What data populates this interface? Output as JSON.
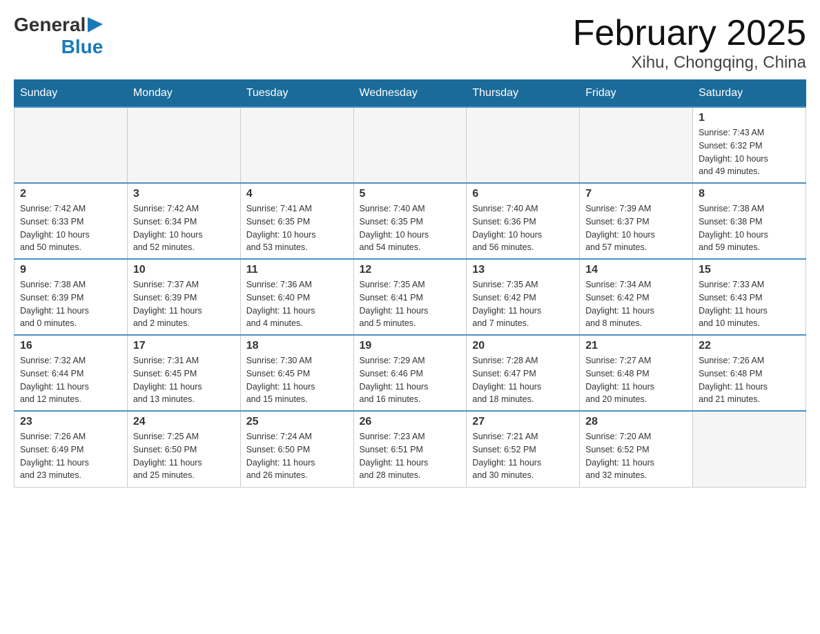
{
  "header": {
    "logo_text_general": "General",
    "logo_text_blue": "Blue",
    "title": "February 2025",
    "subtitle": "Xihu, Chongqing, China"
  },
  "days_of_week": [
    "Sunday",
    "Monday",
    "Tuesday",
    "Wednesday",
    "Thursday",
    "Friday",
    "Saturday"
  ],
  "weeks": [
    [
      {
        "day": "",
        "info": ""
      },
      {
        "day": "",
        "info": ""
      },
      {
        "day": "",
        "info": ""
      },
      {
        "day": "",
        "info": ""
      },
      {
        "day": "",
        "info": ""
      },
      {
        "day": "",
        "info": ""
      },
      {
        "day": "1",
        "info": "Sunrise: 7:43 AM\nSunset: 6:32 PM\nDaylight: 10 hours\nand 49 minutes."
      }
    ],
    [
      {
        "day": "2",
        "info": "Sunrise: 7:42 AM\nSunset: 6:33 PM\nDaylight: 10 hours\nand 50 minutes."
      },
      {
        "day": "3",
        "info": "Sunrise: 7:42 AM\nSunset: 6:34 PM\nDaylight: 10 hours\nand 52 minutes."
      },
      {
        "day": "4",
        "info": "Sunrise: 7:41 AM\nSunset: 6:35 PM\nDaylight: 10 hours\nand 53 minutes."
      },
      {
        "day": "5",
        "info": "Sunrise: 7:40 AM\nSunset: 6:35 PM\nDaylight: 10 hours\nand 54 minutes."
      },
      {
        "day": "6",
        "info": "Sunrise: 7:40 AM\nSunset: 6:36 PM\nDaylight: 10 hours\nand 56 minutes."
      },
      {
        "day": "7",
        "info": "Sunrise: 7:39 AM\nSunset: 6:37 PM\nDaylight: 10 hours\nand 57 minutes."
      },
      {
        "day": "8",
        "info": "Sunrise: 7:38 AM\nSunset: 6:38 PM\nDaylight: 10 hours\nand 59 minutes."
      }
    ],
    [
      {
        "day": "9",
        "info": "Sunrise: 7:38 AM\nSunset: 6:39 PM\nDaylight: 11 hours\nand 0 minutes."
      },
      {
        "day": "10",
        "info": "Sunrise: 7:37 AM\nSunset: 6:39 PM\nDaylight: 11 hours\nand 2 minutes."
      },
      {
        "day": "11",
        "info": "Sunrise: 7:36 AM\nSunset: 6:40 PM\nDaylight: 11 hours\nand 4 minutes."
      },
      {
        "day": "12",
        "info": "Sunrise: 7:35 AM\nSunset: 6:41 PM\nDaylight: 11 hours\nand 5 minutes."
      },
      {
        "day": "13",
        "info": "Sunrise: 7:35 AM\nSunset: 6:42 PM\nDaylight: 11 hours\nand 7 minutes."
      },
      {
        "day": "14",
        "info": "Sunrise: 7:34 AM\nSunset: 6:42 PM\nDaylight: 11 hours\nand 8 minutes."
      },
      {
        "day": "15",
        "info": "Sunrise: 7:33 AM\nSunset: 6:43 PM\nDaylight: 11 hours\nand 10 minutes."
      }
    ],
    [
      {
        "day": "16",
        "info": "Sunrise: 7:32 AM\nSunset: 6:44 PM\nDaylight: 11 hours\nand 12 minutes."
      },
      {
        "day": "17",
        "info": "Sunrise: 7:31 AM\nSunset: 6:45 PM\nDaylight: 11 hours\nand 13 minutes."
      },
      {
        "day": "18",
        "info": "Sunrise: 7:30 AM\nSunset: 6:45 PM\nDaylight: 11 hours\nand 15 minutes."
      },
      {
        "day": "19",
        "info": "Sunrise: 7:29 AM\nSunset: 6:46 PM\nDaylight: 11 hours\nand 16 minutes."
      },
      {
        "day": "20",
        "info": "Sunrise: 7:28 AM\nSunset: 6:47 PM\nDaylight: 11 hours\nand 18 minutes."
      },
      {
        "day": "21",
        "info": "Sunrise: 7:27 AM\nSunset: 6:48 PM\nDaylight: 11 hours\nand 20 minutes."
      },
      {
        "day": "22",
        "info": "Sunrise: 7:26 AM\nSunset: 6:48 PM\nDaylight: 11 hours\nand 21 minutes."
      }
    ],
    [
      {
        "day": "23",
        "info": "Sunrise: 7:26 AM\nSunset: 6:49 PM\nDaylight: 11 hours\nand 23 minutes."
      },
      {
        "day": "24",
        "info": "Sunrise: 7:25 AM\nSunset: 6:50 PM\nDaylight: 11 hours\nand 25 minutes."
      },
      {
        "day": "25",
        "info": "Sunrise: 7:24 AM\nSunset: 6:50 PM\nDaylight: 11 hours\nand 26 minutes."
      },
      {
        "day": "26",
        "info": "Sunrise: 7:23 AM\nSunset: 6:51 PM\nDaylight: 11 hours\nand 28 minutes."
      },
      {
        "day": "27",
        "info": "Sunrise: 7:21 AM\nSunset: 6:52 PM\nDaylight: 11 hours\nand 30 minutes."
      },
      {
        "day": "28",
        "info": "Sunrise: 7:20 AM\nSunset: 6:52 PM\nDaylight: 11 hours\nand 32 minutes."
      },
      {
        "day": "",
        "info": ""
      }
    ]
  ]
}
